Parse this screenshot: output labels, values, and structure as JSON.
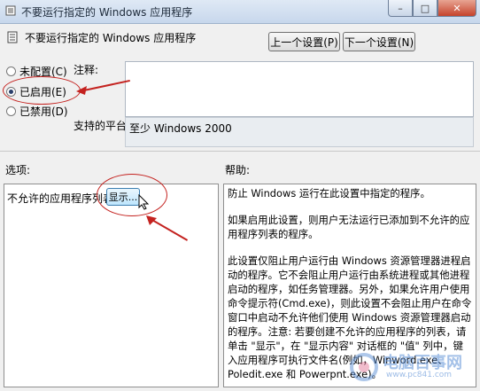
{
  "window": {
    "title": "不要运行指定的 Windows 应用程序",
    "minimize": "–",
    "maximize": "□",
    "close": "✕"
  },
  "policy": {
    "name": "不要运行指定的 Windows 应用程序"
  },
  "nav": {
    "prev": "上一个设置(P)",
    "next": "下一个设置(N)"
  },
  "state": {
    "options": [
      {
        "label": "未配置(C)",
        "selected": false
      },
      {
        "label": "已启用(E)",
        "selected": true
      },
      {
        "label": "已禁用(D)",
        "selected": false
      }
    ]
  },
  "comment": {
    "label": "注释:",
    "value": ""
  },
  "platform": {
    "label": "支持的平台:",
    "value": "至少 Windows 2000"
  },
  "options_section": {
    "label": "选项:",
    "list_label": "不允许的应用程序列表",
    "show_button": "显示..."
  },
  "help_section": {
    "label": "帮助:",
    "paragraphs": [
      "防止 Windows 运行在此设置中指定的程序。",
      "如果启用此设置，则用户无法运行已添加到不允许的应用程序列表的程序。",
      "此设置仅阻止用户运行由 Windows 资源管理器进程启动的程序。它不会阻止用户运行由系统进程或其他进程启动的程序，如任务管理器。另外，如果允许用户使用命令提示符(Cmd.exe)，则此设置不会阻止用户在命令窗口中启动不允许他们使用 Windows 资源管理器启动的程序。注意: 若要创建不允许的应用程序的列表，请单击 \"显示\"，在 \"显示内容\" 对话框的 \"值\" 列中，键入应用程序可执行文件名(例如，Winword.exe、Poledit.exe 和 Powerpnt.exe)。"
    ]
  },
  "watermark": {
    "text": "电脑百事网",
    "url": "www.pc841.com"
  },
  "colors": {
    "annotation": "#c4221f",
    "title_bar": "#c7d7ec",
    "selected_dot": "#2a3f6b"
  }
}
